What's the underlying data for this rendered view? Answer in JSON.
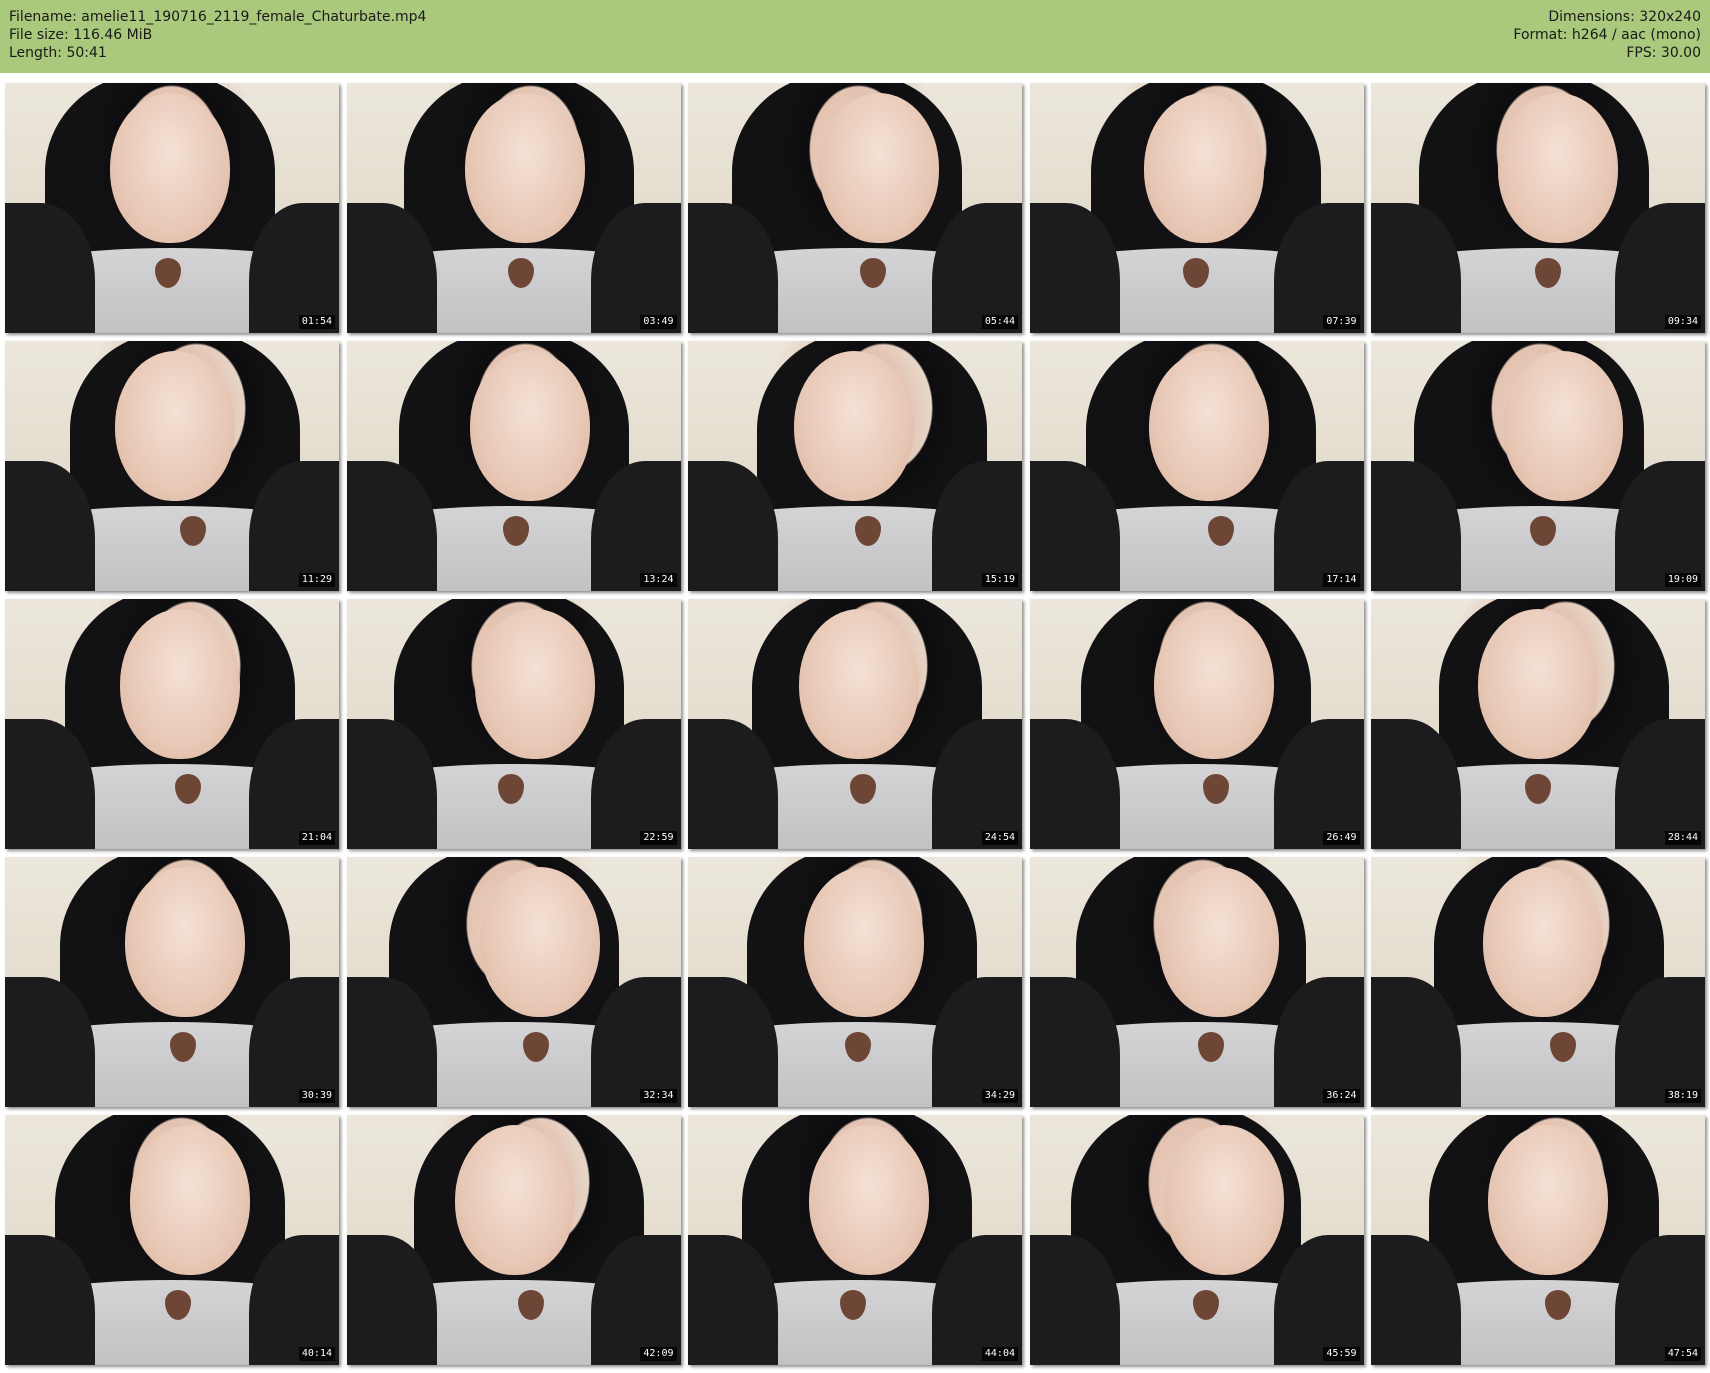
{
  "header": {
    "filename_line": "Filename: amelie11_190716_2119_female_Chaturbate.mp4",
    "filesize_line": "File size: 116.46 MiB",
    "length_line": "Length: 50:41",
    "dimensions_line": "Dimensions: 320x240",
    "format_line": "Format: h264 / aac (mono)",
    "fps_line": "FPS: 30.00"
  },
  "colors": {
    "header_bg": "#abc97c",
    "timestamp_bg": "#000000"
  },
  "thumbnails": [
    {
      "time": "01:54"
    },
    {
      "time": "03:49"
    },
    {
      "time": "05:44"
    },
    {
      "time": "07:39"
    },
    {
      "time": "09:34"
    },
    {
      "time": "11:29"
    },
    {
      "time": "13:24"
    },
    {
      "time": "15:19"
    },
    {
      "time": "17:14"
    },
    {
      "time": "19:09"
    },
    {
      "time": "21:04"
    },
    {
      "time": "22:59"
    },
    {
      "time": "24:54"
    },
    {
      "time": "26:49"
    },
    {
      "time": "28:44"
    },
    {
      "time": "30:39"
    },
    {
      "time": "32:34"
    },
    {
      "time": "34:29"
    },
    {
      "time": "36:24"
    },
    {
      "time": "38:19"
    },
    {
      "time": "40:14"
    },
    {
      "time": "42:09"
    },
    {
      "time": "44:04"
    },
    {
      "time": "45:59"
    },
    {
      "time": "47:54"
    }
  ]
}
